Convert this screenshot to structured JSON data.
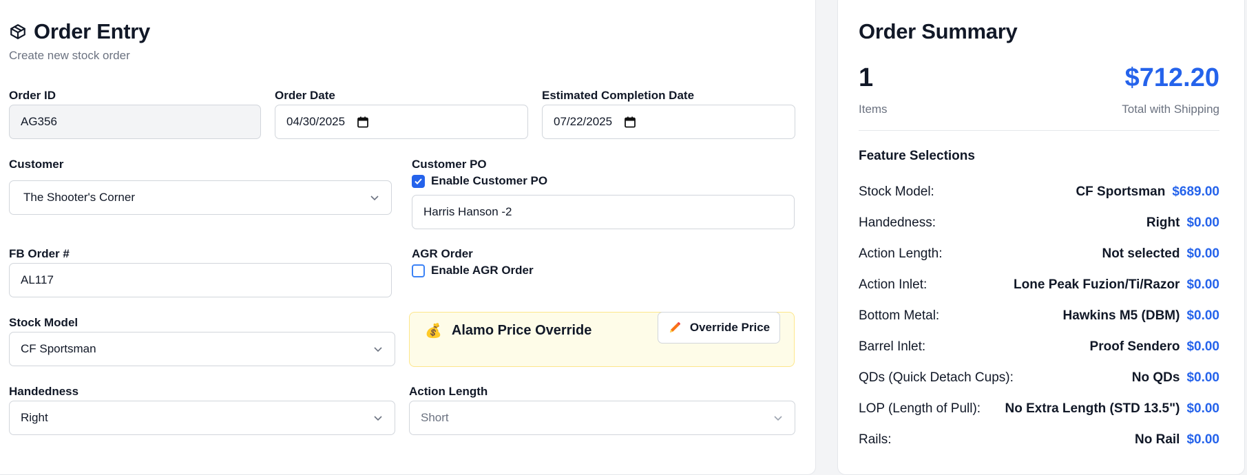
{
  "header": {
    "title": "Order Entry",
    "subtitle": "Create new stock order"
  },
  "form": {
    "order_id": {
      "label": "Order ID",
      "value": "AG356"
    },
    "order_date": {
      "label": "Order Date",
      "value": "04/30/2025"
    },
    "est_completion": {
      "label": "Estimated Completion Date",
      "value": "07/22/2025"
    },
    "customer": {
      "label": "Customer",
      "value": "The Shooter's Corner"
    },
    "customer_po": {
      "label": "Customer PO",
      "enable_label": "Enable Customer PO",
      "enabled": true,
      "value": "Harris Hanson -2"
    },
    "fb_order": {
      "label": "FB Order #",
      "value": "AL117"
    },
    "agr_order": {
      "label": "AGR Order",
      "enable_label": "Enable AGR Order",
      "enabled": false
    },
    "stock_model": {
      "label": "Stock Model",
      "value": "CF Sportsman"
    },
    "price_override": {
      "title": "Alamo Price Override",
      "icon": "money-bag-icon",
      "button_label": "Override Price",
      "button_icon": "pencil-icon"
    },
    "handedness": {
      "label": "Handedness",
      "value": "Right"
    },
    "action_length": {
      "label": "Action Length",
      "value": "Short"
    }
  },
  "summary": {
    "title": "Order Summary",
    "item_count": "1",
    "item_count_label": "Items",
    "total": "$712.20",
    "total_label": "Total with Shipping",
    "features_heading": "Feature Selections",
    "features": [
      {
        "label": "Stock Model:",
        "value": "CF Sportsman",
        "price": "$689.00"
      },
      {
        "label": "Handedness:",
        "value": "Right",
        "price": "$0.00"
      },
      {
        "label": "Action Length:",
        "value": "Not selected",
        "price": "$0.00"
      },
      {
        "label": "Action Inlet:",
        "value": "Lone Peak Fuzion/Ti/Razor",
        "price": "$0.00"
      },
      {
        "label": "Bottom Metal:",
        "value": "Hawkins M5 (DBM)",
        "price": "$0.00"
      },
      {
        "label": "Barrel Inlet:",
        "value": "Proof Sendero",
        "price": "$0.00"
      },
      {
        "label": "QDs (Quick Detach Cups):",
        "value": "No QDs",
        "price": "$0.00"
      },
      {
        "label": "LOP (Length of Pull):",
        "value": "No Extra Length (STD 13.5\")",
        "price": "$0.00"
      },
      {
        "label": "Rails:",
        "value": "No Rail",
        "price": "$0.00"
      }
    ]
  },
  "colors": {
    "accent": "#2563eb",
    "override_bg": "#fefce8"
  }
}
